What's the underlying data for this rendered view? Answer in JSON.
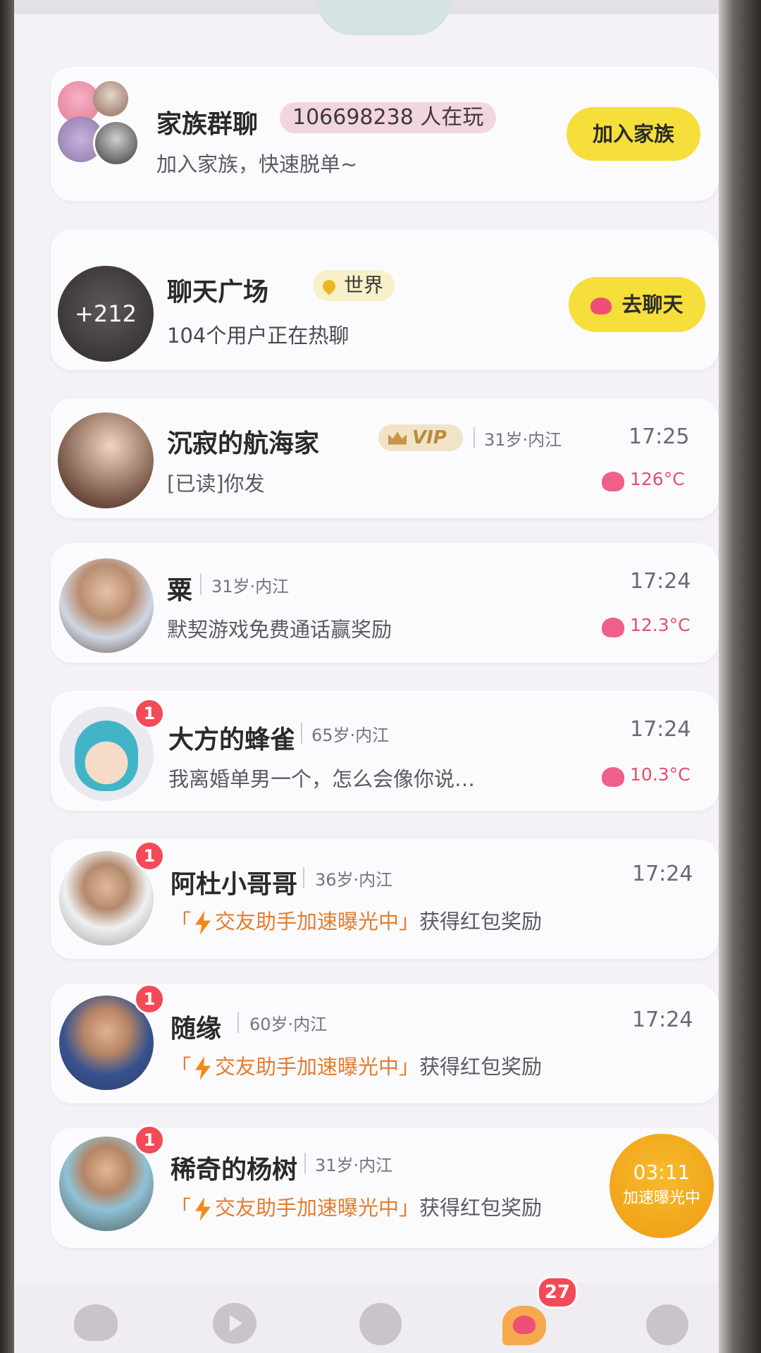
{
  "family": {
    "title": "家族群聊",
    "players": "106698238 人在玩",
    "subtitle": "加入家族，快速脱单~",
    "button": "加入家族"
  },
  "plaza": {
    "title": "聊天广场",
    "location": "世界",
    "subtitle": "104个用户正在热聊",
    "avatar_count": "+212",
    "button": "去聊天"
  },
  "chats": [
    {
      "name": "沉寂的航海家",
      "vip": "VIP",
      "meta": "31岁·内江",
      "message": "[已读]你发",
      "time": "17:25",
      "temp": "126°C",
      "badge": ""
    },
    {
      "name": "粟",
      "meta": "31岁·内江",
      "message": "默契游戏免费通话赢奖励",
      "time": "17:24",
      "temp": "12.3°C",
      "badge": ""
    },
    {
      "name": "大方的蜂雀",
      "meta": "65岁·内江",
      "message": "我离婚单男一个，怎么会像你说…",
      "time": "17:24",
      "temp": "10.3°C",
      "badge": "1"
    },
    {
      "name": "阿杜小哥哥",
      "meta": "36岁·内江",
      "tip_open": "「",
      "tip": "交友助手加速曝光中",
      "tip_close": "」",
      "tip_rest": "获得红包奖励",
      "time": "17:24",
      "badge": "1"
    },
    {
      "name": "随缘",
      "meta": "60岁·内江",
      "tip_open": "「",
      "tip": "交友助手加速曝光中",
      "tip_close": "」",
      "tip_rest": "获得红包奖励",
      "time": "17:24",
      "badge": "1"
    },
    {
      "name": "稀奇的杨树",
      "meta": "31岁·内江",
      "tip_open": "「",
      "tip": "交友助手加速曝光中",
      "tip_close": "」",
      "tip_rest": "获得红包奖励",
      "time": "",
      "badge": "1"
    }
  ],
  "boost": {
    "timer": "03:11",
    "label": "加速曝光中"
  },
  "nav": {
    "messages_badge": "27"
  },
  "colors": {
    "accent_yellow": "#f6de3b",
    "badge_red": "#f24a56",
    "tip_orange": "#e37d2f",
    "temp_pink": "#e2516b",
    "boost_orange": "#f2a91d"
  }
}
